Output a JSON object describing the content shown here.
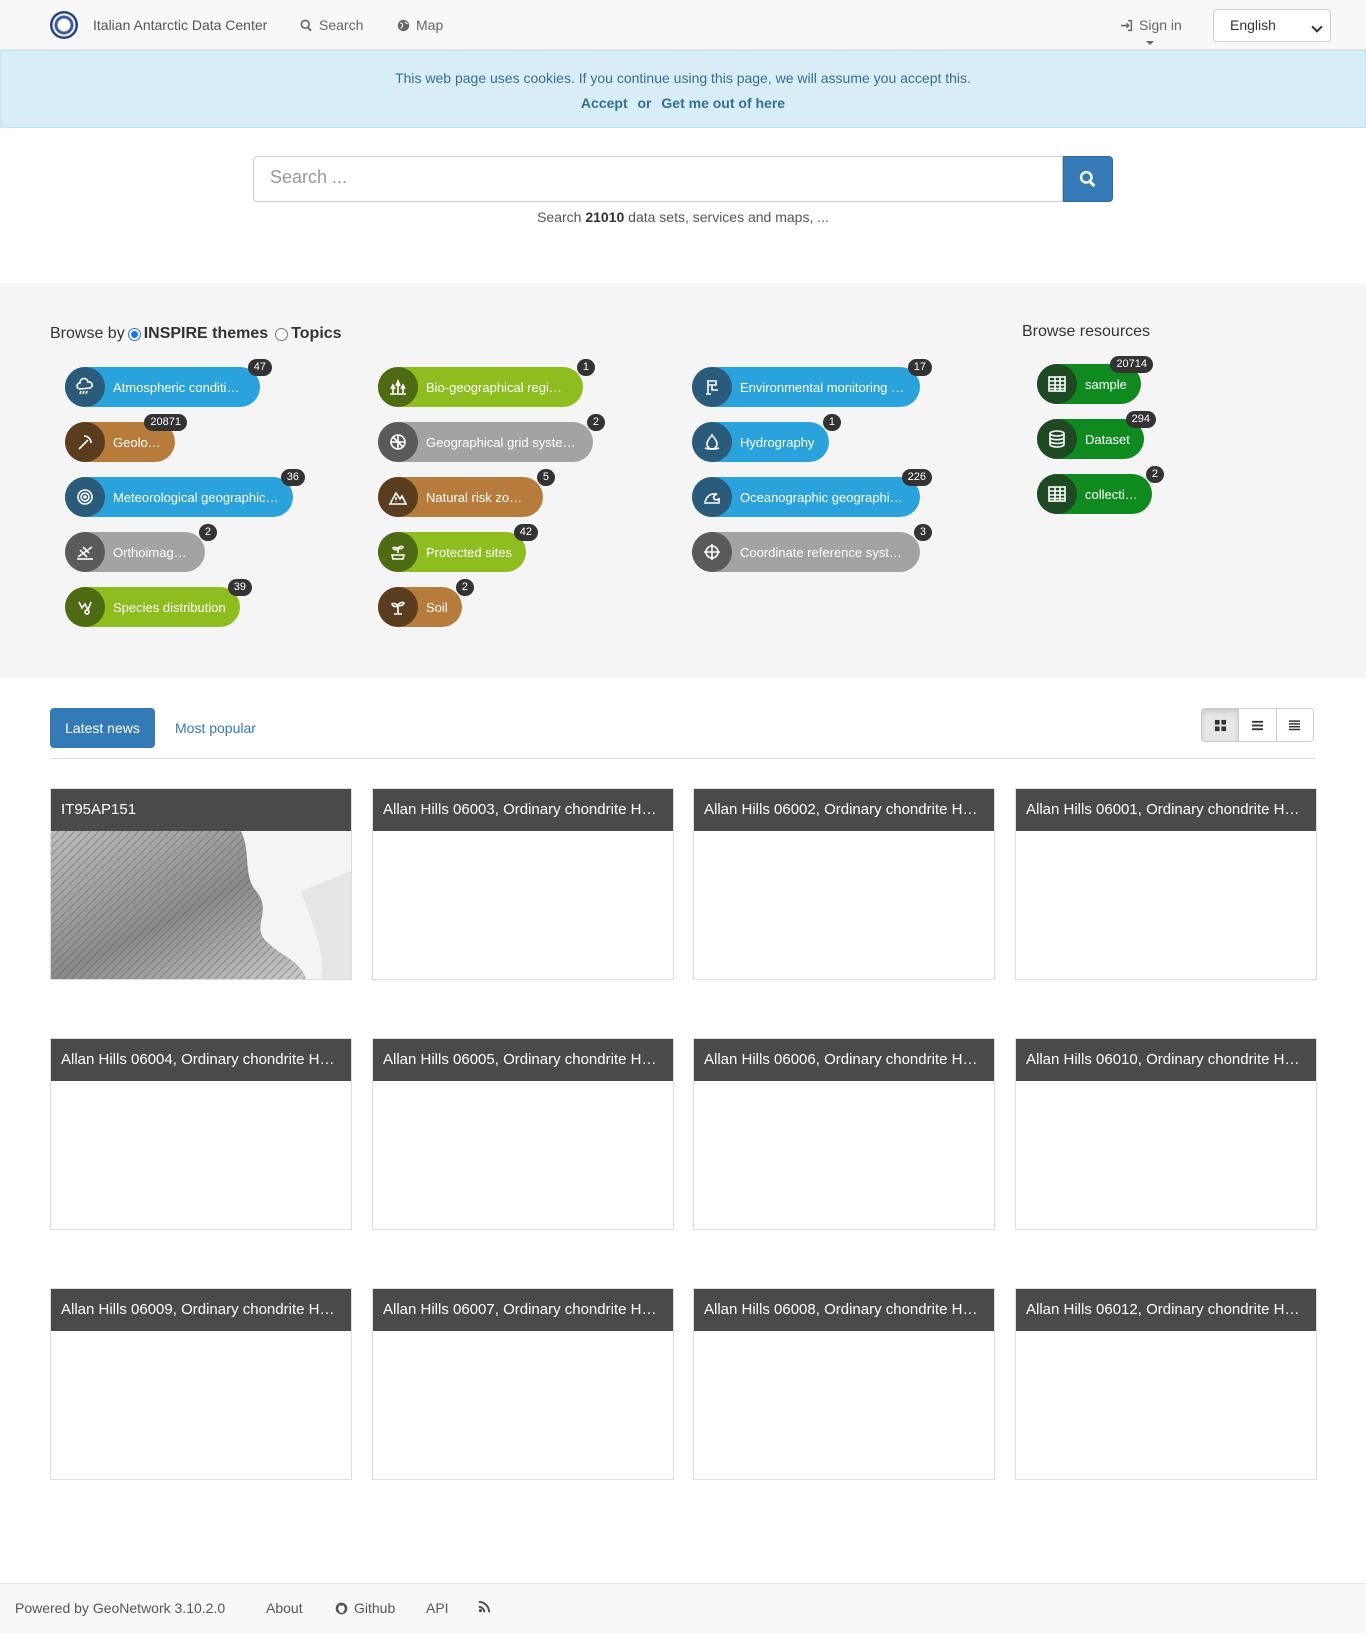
{
  "navbar": {
    "site_name": "Italian Antarctic Data Center",
    "search_label": "Search",
    "map_label": "Map",
    "signin_label": "Sign in",
    "language": "English"
  },
  "cookie": {
    "message": "This web page uses cookies. If you continue using this page, we will assume you accept this.",
    "accept": "Accept",
    "or": "or",
    "leave": "Get me out of here"
  },
  "search": {
    "placeholder": "Search ...",
    "count_prefix": "Search",
    "count": "21010",
    "count_suffix": "data sets, services and maps, ..."
  },
  "browse": {
    "prefix": "Browse by",
    "option_inspire": "INSPIRE themes",
    "option_topics": "Topics",
    "themes": [
      {
        "label": "Atmospheric conditions",
        "count": "47",
        "color": "blue",
        "icon": "cloud-rain-icon"
      },
      {
        "label": "Bio-geographical regions",
        "count": "1",
        "color": "green",
        "icon": "forest-icon"
      },
      {
        "label": "Environmental monitoring …",
        "count": "17",
        "color": "blue",
        "icon": "monitoring-station-icon"
      },
      {
        "label": "Geology",
        "count": "20871",
        "color": "brown",
        "icon": "pickaxe-icon"
      },
      {
        "label": "Geographical grid systems",
        "count": "2",
        "color": "grey",
        "icon": "grid-globe-icon"
      },
      {
        "label": "Hydrography",
        "count": "1",
        "color": "blue",
        "icon": "water-drop-icon"
      },
      {
        "label": "Meteorological geographic…",
        "count": "36",
        "color": "blue",
        "icon": "weather-radar-icon"
      },
      {
        "label": "Natural risk zones",
        "count": "5",
        "color": "brown",
        "icon": "mountain-alert-icon"
      },
      {
        "label": "Oceanographic geographi…",
        "count": "226",
        "color": "blue",
        "icon": "wave-icon"
      },
      {
        "label": "Orthoimagery",
        "count": "2",
        "color": "grey",
        "icon": "satellite-icon"
      },
      {
        "label": "Protected sites",
        "count": "42",
        "color": "green",
        "icon": "protected-plant-icon"
      },
      {
        "label": "Coordinate reference syst…",
        "count": "3",
        "color": "grey",
        "icon": "crosshair-icon"
      },
      {
        "label": "Species distribution",
        "count": "39",
        "color": "green",
        "icon": "species-icon"
      },
      {
        "label": "Soil",
        "count": "2",
        "color": "brown",
        "icon": "sprout-icon"
      }
    ]
  },
  "resources": {
    "title": "Browse resources",
    "items": [
      {
        "label": "sample",
        "count": "20714",
        "icon": "table-icon"
      },
      {
        "label": "Dataset",
        "count": "294",
        "icon": "database-icon"
      },
      {
        "label": "collection",
        "count": "2",
        "icon": "table-icon"
      }
    ]
  },
  "tabs": {
    "latest": "Latest news",
    "popular": "Most popular"
  },
  "cards": [
    "IT95AP151",
    "Allan Hills 06003, Ordinary chondrite H…",
    "Allan Hills 06002, Ordinary chondrite H…",
    "Allan Hills 06001, Ordinary chondrite H…",
    "Allan Hills 06004, Ordinary chondrite H…",
    "Allan Hills 06005, Ordinary chondrite H…",
    "Allan Hills 06006, Ordinary chondrite H…",
    "Allan Hills 06010, Ordinary chondrite H…",
    "Allan Hills 06009, Ordinary chondrite H…",
    "Allan Hills 06007, Ordinary chondrite H…",
    "Allan Hills 06008, Ordinary chondrite H…",
    "Allan Hills 06012, Ordinary chondrite H…"
  ],
  "footer": {
    "powered": "Powered by GeoNetwork 3.10.2.0",
    "about": "About",
    "github": "Github",
    "api": "API"
  }
}
